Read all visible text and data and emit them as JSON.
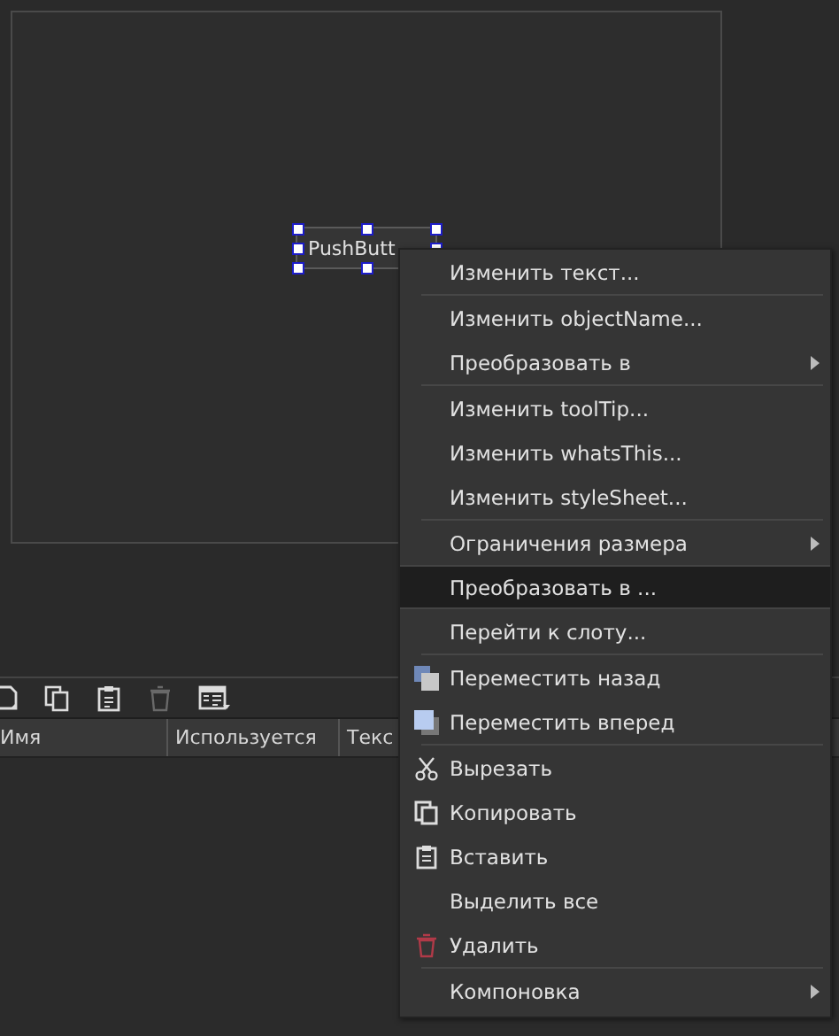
{
  "form": {
    "widget": {
      "label": "PushButt",
      "selected": true
    }
  },
  "toolbar": {
    "items": [
      {
        "kind": "new",
        "disabled": false
      },
      {
        "kind": "copy",
        "disabled": false
      },
      {
        "kind": "paste",
        "disabled": false
      },
      {
        "kind": "delete",
        "disabled": true
      },
      {
        "kind": "view",
        "disabled": false
      }
    ]
  },
  "table": {
    "columns": [
      "Имя",
      "Используется",
      "Текс"
    ]
  },
  "context_menu": {
    "groups": [
      [
        {
          "label": "Изменить текст...",
          "kind": "plain",
          "selected": false
        }
      ],
      [
        {
          "label": "Изменить objectName...",
          "kind": "plain",
          "selected": false
        },
        {
          "label": "Преобразовать в",
          "kind": "submenu",
          "selected": false
        }
      ],
      [
        {
          "label": "Изменить toolTip...",
          "kind": "plain",
          "selected": false
        },
        {
          "label": "Изменить whatsThis...",
          "kind": "plain",
          "selected": false
        },
        {
          "label": "Изменить styleSheet...",
          "kind": "plain",
          "selected": false
        }
      ],
      [
        {
          "label": "Ограничения размера",
          "kind": "submenu",
          "selected": false
        },
        {
          "label": "Преобразовать в ...",
          "kind": "plain",
          "selected": true
        },
        {
          "label": "Перейти к слоту...",
          "kind": "plain",
          "selected": false
        }
      ],
      [
        {
          "label": "Переместить назад",
          "kind": "back",
          "selected": false
        },
        {
          "label": "Переместить вперед",
          "kind": "front",
          "selected": false
        }
      ],
      [
        {
          "label": "Вырезать",
          "kind": "cut",
          "selected": false
        },
        {
          "label": "Копировать",
          "kind": "copy",
          "selected": false
        },
        {
          "label": "Вставить",
          "kind": "paste",
          "selected": false
        },
        {
          "label": "Выделить все",
          "kind": "plain",
          "selected": false
        },
        {
          "label": "Удалить",
          "kind": "delete",
          "selected": false
        }
      ],
      [
        {
          "label": "Компоновка",
          "kind": "submenu",
          "selected": false
        }
      ]
    ]
  }
}
